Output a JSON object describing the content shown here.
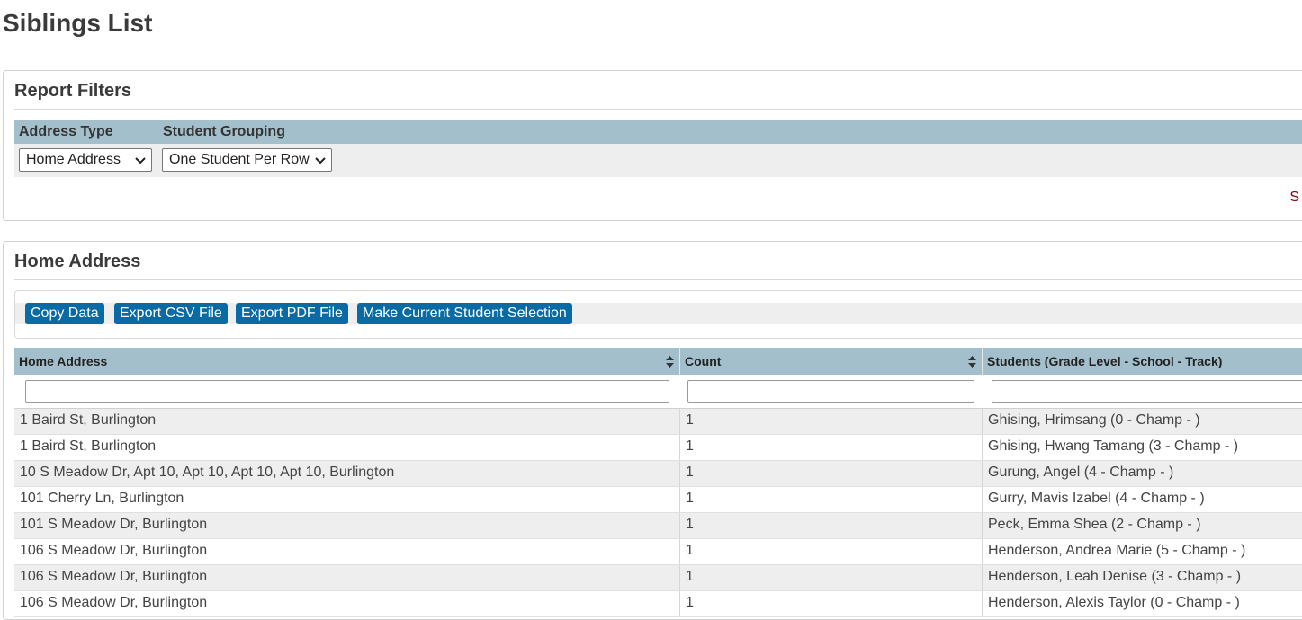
{
  "page": {
    "title": "Siblings List"
  },
  "filters": {
    "title": "Report Filters",
    "address_type_label": "Address Type",
    "student_grouping_label": "Student Grouping",
    "address_type_value": "Home Address",
    "student_grouping_value": "One Student Per Row",
    "cutoff_text": "S"
  },
  "results": {
    "title": "Home Address",
    "buttons": {
      "copy": "Copy Data",
      "csv": "Export CSV File",
      "pdf": "Export PDF File",
      "selection": "Make Current Student Selection"
    },
    "columns": [
      "Home Address",
      "Count",
      "Students (Grade Level - School - Track)"
    ],
    "rows": [
      [
        "1 Baird St, Burlington",
        "1",
        "Ghising, Hrimsang (0 - Champ - )"
      ],
      [
        "1 Baird St, Burlington",
        "1",
        "Ghising, Hwang Tamang (3 - Champ - )"
      ],
      [
        "10 S Meadow Dr, Apt 10, Apt 10, Apt 10, Apt 10, Burlington",
        "1",
        "Gurung, Angel (4 - Champ - )"
      ],
      [
        "101 Cherry Ln, Burlington",
        "1",
        "Gurry, Mavis Izabel (4 - Champ - )"
      ],
      [
        "101 S Meadow Dr, Burlington",
        "1",
        "Peck, Emma Shea (2 - Champ - )"
      ],
      [
        "106 S Meadow Dr, Burlington",
        "1",
        "Henderson, Andrea Marie (5 - Champ - )"
      ],
      [
        "106 S Meadow Dr, Burlington",
        "1",
        "Henderson, Leah Denise (3 - Champ - )"
      ],
      [
        "106 S Meadow Dr, Burlington",
        "1",
        "Henderson, Alexis Taylor (0 - Champ - )"
      ]
    ]
  },
  "colors": {
    "header_bg": "#a3bfcb",
    "button_bg": "#0a6aa3",
    "row_alt_bg": "#eeeeee",
    "cutoff_text": "#8b0000"
  }
}
